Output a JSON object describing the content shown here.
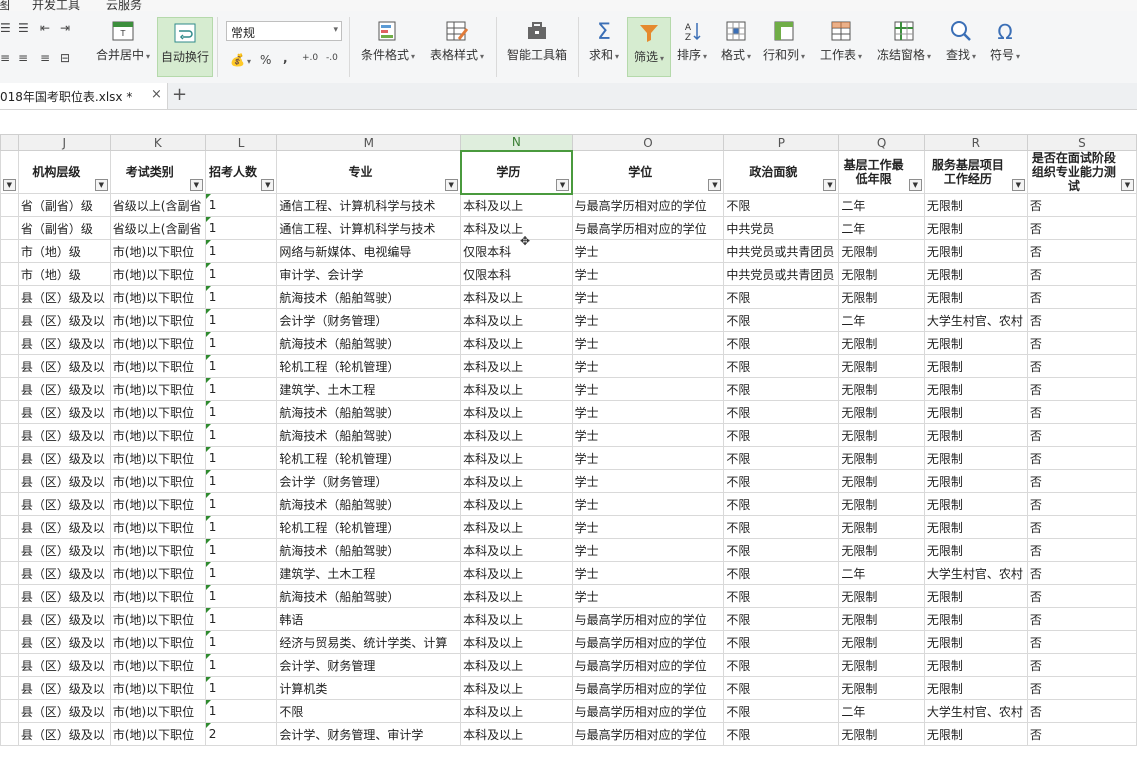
{
  "menu": {
    "items": [
      "图",
      "开发工具",
      "云服务"
    ]
  },
  "ribbon": {
    "merge_label": "合并居中",
    "wrap_label": "自动换行",
    "number_format": "常规",
    "percent": "%",
    "comma": ",",
    "decimal_inc": "+.0",
    "decimal_dec": "-.0",
    "cond_format_label": "条件格式",
    "table_style_label": "表格样式",
    "smart_tools_label": "智能工具箱",
    "sum_label": "求和",
    "filter_label": "筛选",
    "sort_label": "排序",
    "format_label": "格式",
    "rowcol_label": "行和列",
    "sheet_label": "工作表",
    "freeze_label": "冻结窗格",
    "find_label": "查找",
    "symbol_label": "符号"
  },
  "tabs": {
    "file_name": "018年国考职位表.xlsx *",
    "close": "×",
    "add": "+"
  },
  "grid": {
    "columns": [
      "J",
      "K",
      "L",
      "M",
      "N",
      "O",
      "P",
      "Q",
      "R",
      "S"
    ],
    "headers": [
      "机构层级",
      "考试类别",
      "招考人数",
      "专业",
      "学历",
      "学位",
      "政治面貌",
      "基层工作最低年限",
      "服务基层项目工作经历",
      "是否在面试阶段组织专业能力测试"
    ],
    "rows": [
      [
        "省（副省）级",
        "省级以上(含副省",
        "1",
        "通信工程、计算机科学与技术",
        "本科及以上",
        "与最高学历相对应的学位",
        "不限",
        "二年",
        "无限制",
        "否"
      ],
      [
        "省（副省）级",
        "省级以上(含副省",
        "1",
        "通信工程、计算机科学与技术",
        "本科及以上",
        "与最高学历相对应的学位",
        "中共党员",
        "二年",
        "无限制",
        "否"
      ],
      [
        "市（地）级",
        "市(地)以下职位",
        "1",
        "网络与新媒体、电视编导",
        "仅限本科",
        "学士",
        "中共党员或共青团员",
        "无限制",
        "无限制",
        "否"
      ],
      [
        "市（地）级",
        "市(地)以下职位",
        "1",
        "审计学、会计学",
        "仅限本科",
        "学士",
        "中共党员或共青团员",
        "无限制",
        "无限制",
        "否"
      ],
      [
        "县（区）级及以",
        "市(地)以下职位",
        "1",
        "航海技术（船舶驾驶）",
        "本科及以上",
        "学士",
        "不限",
        "无限制",
        "无限制",
        "否"
      ],
      [
        "县（区）级及以",
        "市(地)以下职位",
        "1",
        "会计学（财务管理）",
        "本科及以上",
        "学士",
        "不限",
        "二年",
        "大学生村官、农村",
        "否"
      ],
      [
        "县（区）级及以",
        "市(地)以下职位",
        "1",
        "航海技术（船舶驾驶）",
        "本科及以上",
        "学士",
        "不限",
        "无限制",
        "无限制",
        "否"
      ],
      [
        "县（区）级及以",
        "市(地)以下职位",
        "1",
        "轮机工程（轮机管理）",
        "本科及以上",
        "学士",
        "不限",
        "无限制",
        "无限制",
        "否"
      ],
      [
        "县（区）级及以",
        "市(地)以下职位",
        "1",
        "建筑学、土木工程",
        "本科及以上",
        "学士",
        "不限",
        "无限制",
        "无限制",
        "否"
      ],
      [
        "县（区）级及以",
        "市(地)以下职位",
        "1",
        "航海技术（船舶驾驶）",
        "本科及以上",
        "学士",
        "不限",
        "无限制",
        "无限制",
        "否"
      ],
      [
        "县（区）级及以",
        "市(地)以下职位",
        "1",
        "航海技术（船舶驾驶）",
        "本科及以上",
        "学士",
        "不限",
        "无限制",
        "无限制",
        "否"
      ],
      [
        "县（区）级及以",
        "市(地)以下职位",
        "1",
        "轮机工程（轮机管理）",
        "本科及以上",
        "学士",
        "不限",
        "无限制",
        "无限制",
        "否"
      ],
      [
        "县（区）级及以",
        "市(地)以下职位",
        "1",
        "会计学（财务管理）",
        "本科及以上",
        "学士",
        "不限",
        "无限制",
        "无限制",
        "否"
      ],
      [
        "县（区）级及以",
        "市(地)以下职位",
        "1",
        "航海技术（船舶驾驶）",
        "本科及以上",
        "学士",
        "不限",
        "无限制",
        "无限制",
        "否"
      ],
      [
        "县（区）级及以",
        "市(地)以下职位",
        "1",
        "轮机工程（轮机管理）",
        "本科及以上",
        "学士",
        "不限",
        "无限制",
        "无限制",
        "否"
      ],
      [
        "县（区）级及以",
        "市(地)以下职位",
        "1",
        "航海技术（船舶驾驶）",
        "本科及以上",
        "学士",
        "不限",
        "无限制",
        "无限制",
        "否"
      ],
      [
        "县（区）级及以",
        "市(地)以下职位",
        "1",
        "建筑学、土木工程",
        "本科及以上",
        "学士",
        "不限",
        "二年",
        "大学生村官、农村",
        "否"
      ],
      [
        "县（区）级及以",
        "市(地)以下职位",
        "1",
        "航海技术（船舶驾驶）",
        "本科及以上",
        "学士",
        "不限",
        "无限制",
        "无限制",
        "否"
      ],
      [
        "县（区）级及以",
        "市(地)以下职位",
        "1",
        "韩语",
        "本科及以上",
        "与最高学历相对应的学位",
        "不限",
        "无限制",
        "无限制",
        "否"
      ],
      [
        "县（区）级及以",
        "市(地)以下职位",
        "1",
        "经济与贸易类、统计学类、计算",
        "本科及以上",
        "与最高学历相对应的学位",
        "不限",
        "无限制",
        "无限制",
        "否"
      ],
      [
        "县（区）级及以",
        "市(地)以下职位",
        "1",
        "会计学、财务管理",
        "本科及以上",
        "与最高学历相对应的学位",
        "不限",
        "无限制",
        "无限制",
        "否"
      ],
      [
        "县（区）级及以",
        "市(地)以下职位",
        "1",
        "计算机类",
        "本科及以上",
        "与最高学历相对应的学位",
        "不限",
        "无限制",
        "无限制",
        "否"
      ],
      [
        "县（区）级及以",
        "市(地)以下职位",
        "1",
        "不限",
        "本科及以上",
        "与最高学历相对应的学位",
        "不限",
        "二年",
        "大学生村官、农村",
        "否"
      ],
      [
        "县（区）级及以",
        "市(地)以下职位",
        "2",
        "会计学、财务管理、审计学",
        "本科及以上",
        "与最高学历相对应的学位",
        "不限",
        "无限制",
        "无限制",
        "否"
      ]
    ]
  },
  "colors": {
    "accent": "#4a9a3e",
    "ribbon_bg": "#f5f6f7",
    "grid_line": "#d9d9d9"
  }
}
